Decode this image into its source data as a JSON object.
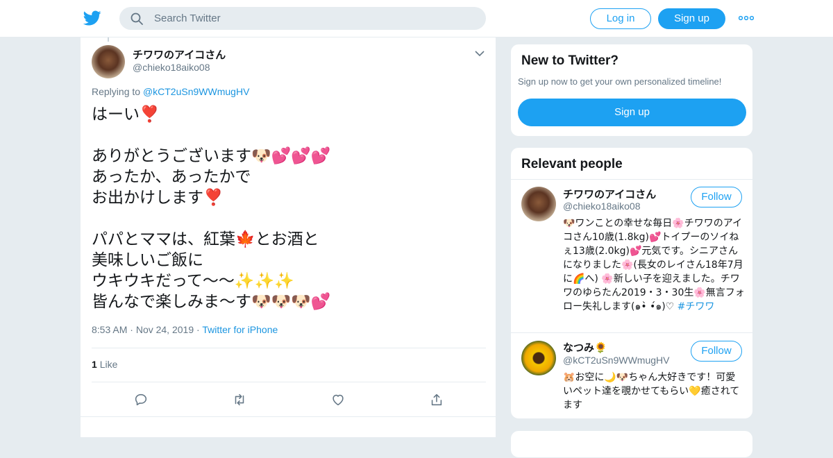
{
  "header": {
    "search_placeholder": "Search Twitter",
    "login_label": "Log in",
    "signup_label": "Sign up",
    "brand_color": "#1da1f2"
  },
  "tweet": {
    "author_name": "チワワのアイコさん",
    "author_handle": "@chieko18aiko08",
    "replying_prefix": "Replying to ",
    "replying_to": "@kCT2uSn9WWmugHV",
    "text": "はーい❣️\n\nありがとうございます🐶💕💕💕\nあったか、あったかで\nお出かけします❣️\n\nパパとママは、紅葉🍁とお酒と\n美味しいご飯に\nウキウキだって〜〜✨✨✨\n皆んなで楽しみま〜す🐶🐶🐶💕",
    "time": "8:53 AM",
    "date": "Nov 24, 2019",
    "source": "Twitter for iPhone",
    "like_count": "1",
    "like_label": "Like"
  },
  "new_to_twitter": {
    "title": "New to Twitter?",
    "subtitle": "Sign up now to get your own personalized timeline!",
    "button_label": "Sign up"
  },
  "relevant_people": {
    "title": "Relevant people",
    "people": [
      {
        "name": "チワワのアイコさん",
        "handle": "@chieko18aiko08",
        "follow_label": "Follow",
        "bio": "🐶ワンことの幸せな毎日🌸チワワのアイコさん10歳(1.8kg)💕トイプーのソイねぇ13歳(2.0kg)💕元気です。シニアさんになりました🌸(長女のレイさん18年7月に🌈へ) 🌸新しい子を迎えました。チワワのゆらたん2019・3・30生🌸無言フォロー失礼します(๑•̀ •́๑)♡",
        "hashtag": "#チワワ"
      },
      {
        "name": "なつみ🌻",
        "handle": "@kCT2uSn9WWmugHV",
        "follow_label": "Follow",
        "bio": "🐹お空に🌙🐶ちゃん大好きです！可愛いペット達を覗かせてもらい💛癒されてます"
      }
    ]
  }
}
